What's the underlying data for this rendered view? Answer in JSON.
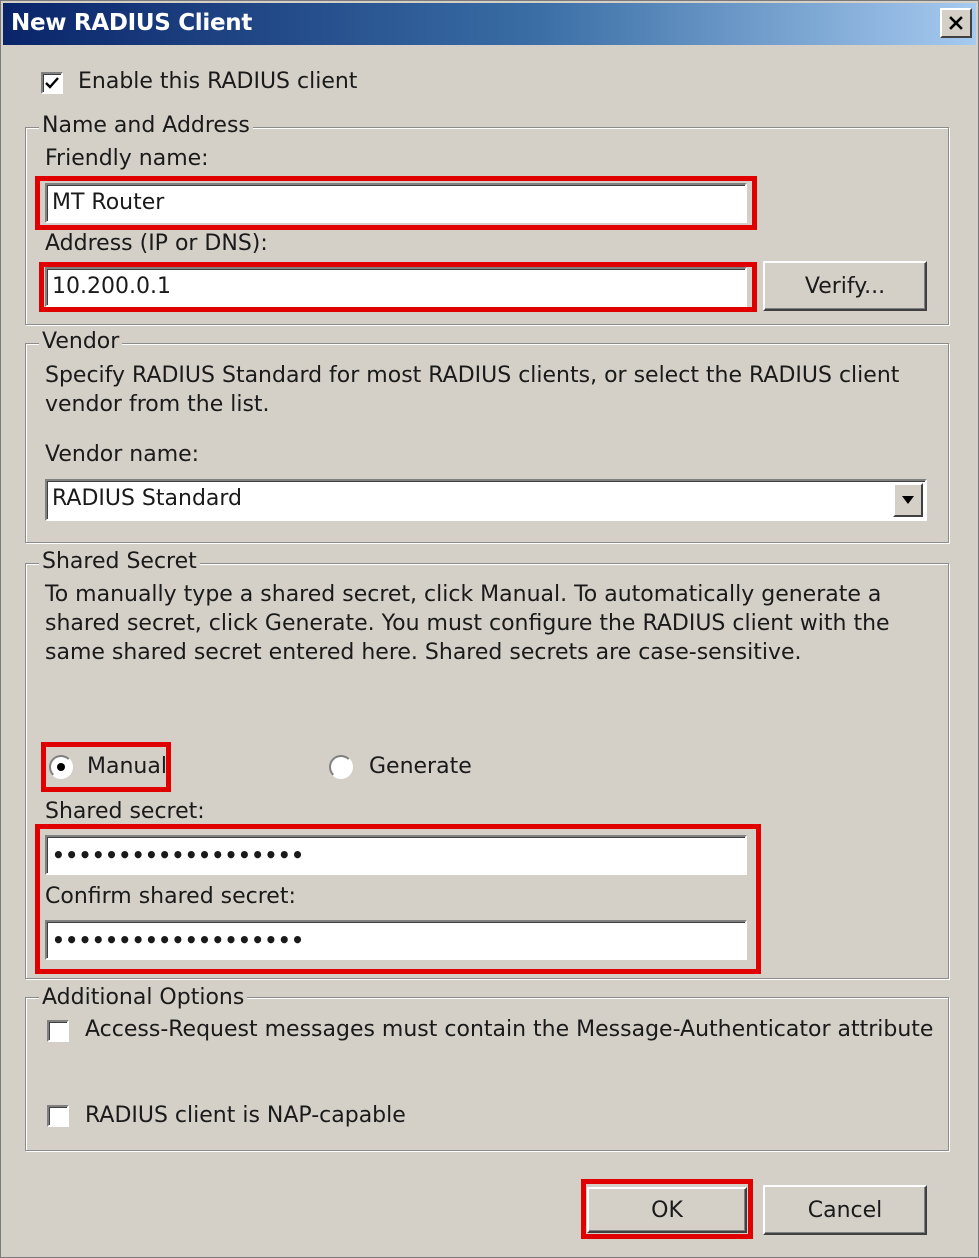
{
  "window": {
    "title": "New RADIUS Client",
    "close_icon": "close-icon"
  },
  "enable_client": {
    "label": "Enable this RADIUS client",
    "checked": true
  },
  "name_address": {
    "legend": "Name and Address",
    "friendly_name_label": "Friendly name:",
    "friendly_name_value": "MT Router",
    "address_label": "Address (IP or DNS):",
    "address_value": "10.200.0.1",
    "verify_button": "Verify..."
  },
  "vendor": {
    "legend": "Vendor",
    "description": "Specify RADIUS Standard for most RADIUS clients, or select the RADIUS client vendor from the list.",
    "vendor_name_label": "Vendor name:",
    "vendor_name_value": "RADIUS Standard"
  },
  "shared_secret": {
    "legend": "Shared Secret",
    "description": "To manually type a shared secret, click Manual. To automatically generate a shared secret, click Generate. You must configure the RADIUS client with the same shared secret entered here. Shared secrets are case-sensitive.",
    "manual_label": "Manual",
    "generate_label": "Generate",
    "selected": "Manual",
    "secret_label": "Shared secret:",
    "secret_value": "•••••••••••••••••••",
    "confirm_label": "Confirm shared secret:",
    "confirm_value": "•••••••••••••••••••"
  },
  "additional": {
    "legend": "Additional Options",
    "message_auth_label": "Access-Request messages must contain the Message-Authenticator attribute",
    "message_auth_checked": false,
    "nap_label": "RADIUS client is NAP-capable",
    "nap_checked": false
  },
  "buttons": {
    "ok": "OK",
    "cancel": "Cancel"
  },
  "colors": {
    "highlight": "#e00000",
    "dialog_bg": "#d4d0c8",
    "title_gradient_start": "#0a246a"
  }
}
